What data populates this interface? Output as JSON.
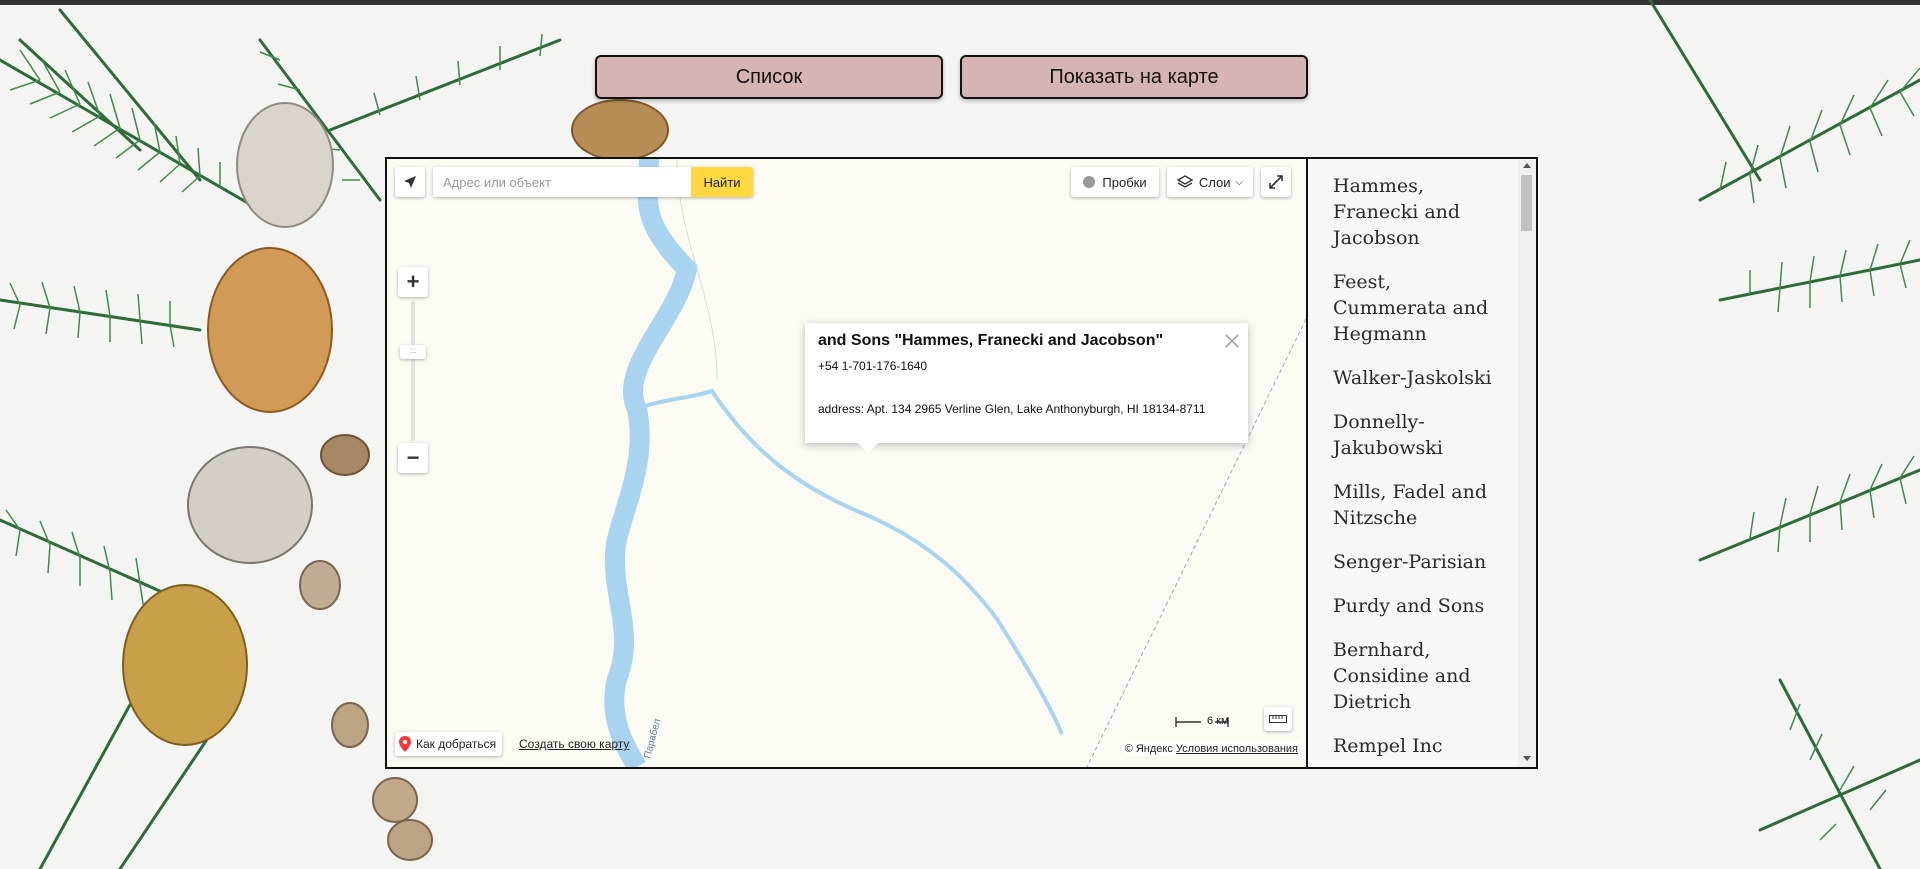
{
  "nav": {
    "list_label": "Список",
    "map_label": "Показать на карте"
  },
  "map": {
    "search_placeholder": "Адрес или объект",
    "search_button": "Найти",
    "traffic_label": "Пробки",
    "layers_label": "Слои",
    "zoom_in": "+",
    "zoom_out": "−",
    "zoom_handle": ":::",
    "route_label": "Как добраться",
    "create_map_label": "Создать свою карту",
    "copyright": "© Яндекс",
    "terms_label": "Условия использования",
    "scale_label": "6 км",
    "balloon": {
      "title": "and Sons \"Hammes, Franecki and Jacobson\"",
      "phone": "+54 1-701-176-1640",
      "address": "address: Apt. 134 2965 Verline Glen, Lake Anthonyburgh, HI 18134-8711"
    }
  },
  "companies": [
    "Hammes, Franecki and Jacobson",
    "Feest, Cummerata and Hegmann",
    "Walker-Jaskolski",
    "Donnelly-Jakubowski",
    "Mills, Fadel and Nitzsche",
    "Senger-Parisian",
    "Purdy and Sons",
    "Bernhard, Considine and Dietrich",
    "Rempel Inc"
  ],
  "colors": {
    "button_bg": "#d6b4b5",
    "search_button_bg": "#fdd83e",
    "river": "#a8d4f0",
    "map_bg": "#fbfaf3"
  }
}
